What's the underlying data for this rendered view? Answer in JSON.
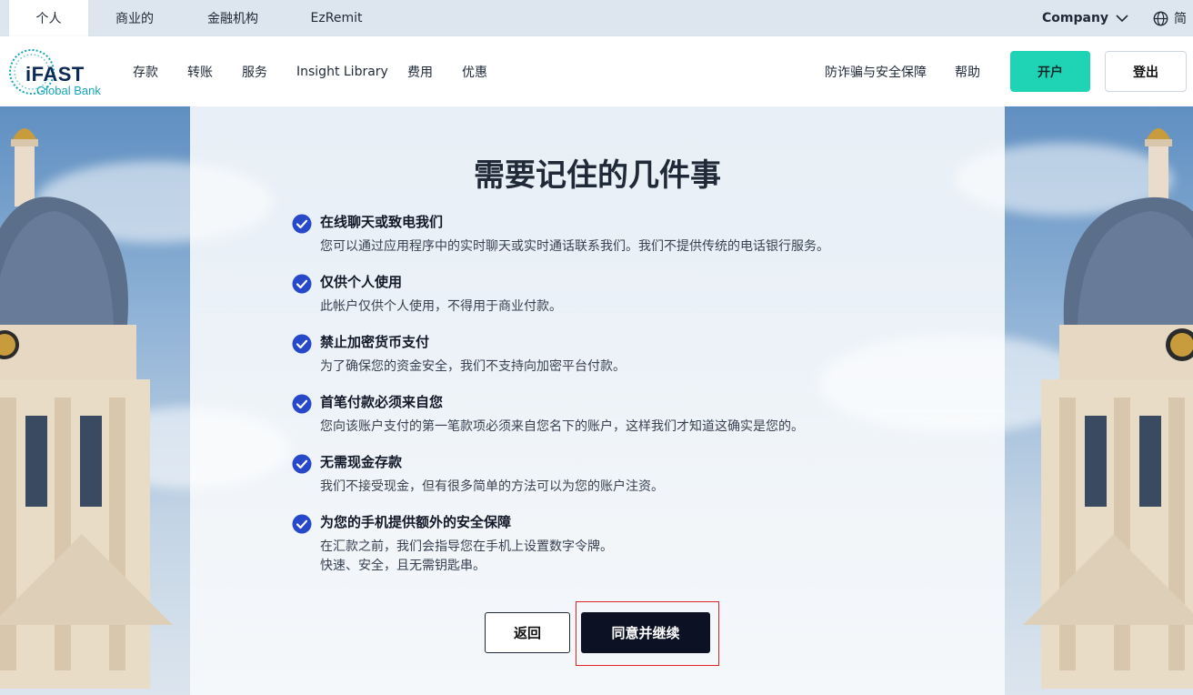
{
  "topbar": {
    "segments": [
      {
        "label": "个人",
        "active": true
      },
      {
        "label": "商业的",
        "active": false
      },
      {
        "label": "金融机构",
        "active": false
      },
      {
        "label": "EzRemit",
        "active": false
      }
    ],
    "company_label": "Company",
    "language_label": "简"
  },
  "brand": {
    "name": "iFAST",
    "subtitle": "Global Bank",
    "primary_color": "#0b2a55",
    "accent_color": "#1fd4b5"
  },
  "nav": {
    "links": [
      "存款",
      "转账",
      "服务",
      "Insight Library",
      "费用",
      "优惠"
    ],
    "right_links": [
      "防诈骗与安全保障",
      "帮助"
    ],
    "open_account_label": "开户",
    "login_label": "登出"
  },
  "modal": {
    "title": "需要记住的几件事",
    "items": [
      {
        "title": "在线聊天或致电我们",
        "desc": "您可以通过应用程序中的实时聊天或实时通话联系我们。我们不提供传统的电话银行服务。"
      },
      {
        "title": "仅供个人使用",
        "desc": "此帐户仅供个人使用，不得用于商业付款。"
      },
      {
        "title": "禁止加密货币支付",
        "desc": "为了确保您的资金安全，我们不支持向加密平台付款。"
      },
      {
        "title": "首笔付款必须来自您",
        "desc": "您向该账户支付的第一笔款项必须来自您名下的账户，这样我们才知道这确实是您的。"
      },
      {
        "title": "无需现金存款",
        "desc": "我们不接受现金，但有很多简单的方法可以为您的账户注资。"
      },
      {
        "title": "为您的手机提供额外的安全保障",
        "desc": "在汇款之前，我们会指导您在手机上设置数字令牌。",
        "desc2": "快速、安全，且无需钥匙串。"
      }
    ],
    "back_label": "返回",
    "agree_label": "同意并继续",
    "check_color": "#2748c8"
  }
}
